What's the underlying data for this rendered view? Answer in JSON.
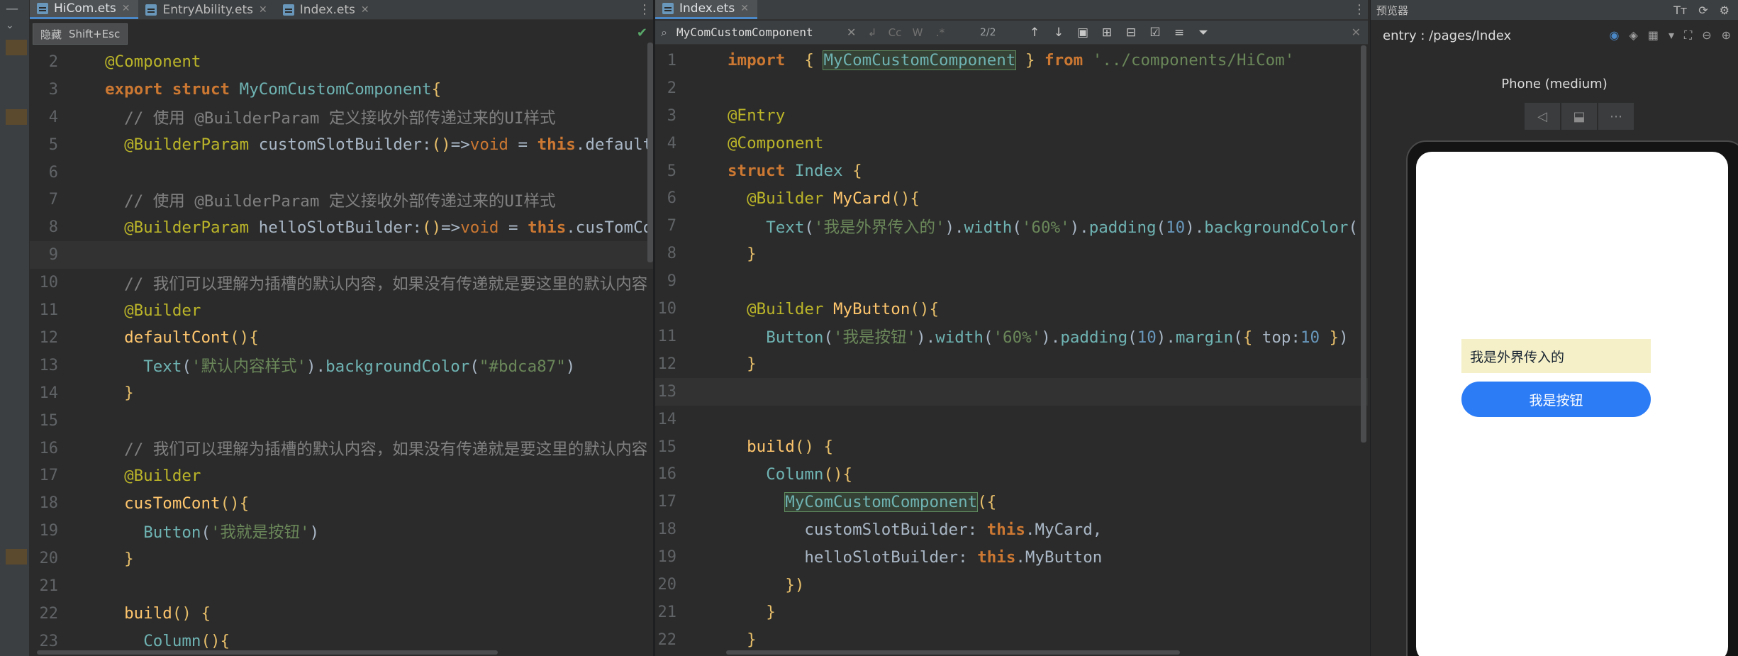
{
  "left_editor": {
    "tabs": [
      {
        "label": "HiCom.ets",
        "active": true
      },
      {
        "label": "EntryAbility.ets",
        "active": false
      },
      {
        "label": "Index.ets",
        "active": false
      }
    ],
    "tooltip": {
      "text": "隐藏",
      "shortcut": "Shift+Esc"
    },
    "lines": [
      {
        "n": "2",
        "html": "<span class=\"ann\">@Component</span>"
      },
      {
        "n": "3",
        "html": "<span class=\"kw\">export struct </span><span class=\"cls\">MyComCustomComponent</span><span class=\"sym\">{</span>"
      },
      {
        "n": "4",
        "html": "  <span class=\"cm\">// 使用 @BuilderParam 定义接收外部传递过来的UI样式</span>"
      },
      {
        "n": "5",
        "html": "  <span class=\"ann\">@BuilderParam</span> customSlotBuilder:<span class=\"sym\">()</span>=&gt;<span class=\"kw2\">void</span> = <span class=\"kw\">this</span>.defaultCont"
      },
      {
        "n": "6",
        "html": ""
      },
      {
        "n": "7",
        "html": "  <span class=\"cm\">// 使用 @BuilderParam 定义接收外部传递过来的UI样式</span>"
      },
      {
        "n": "8",
        "html": "  <span class=\"ann\">@BuilderParam</span> helloSlotBuilder:<span class=\"sym\">()</span>=&gt;<span class=\"kw2\">void</span> = <span class=\"kw\">this</span>.cusTomCont"
      },
      {
        "n": "9",
        "html": "",
        "current": true
      },
      {
        "n": "10",
        "html": "  <span class=\"cm\">// 我们可以理解为插槽的默认内容，如果没有传递就是要这里的默认内容</span>"
      },
      {
        "n": "11",
        "html": "  <span class=\"ann\">@Builder</span>"
      },
      {
        "n": "12",
        "html": "  <span class=\"fn\">defaultCont</span><span class=\"sym\">(){</span>"
      },
      {
        "n": "13",
        "html": "    <span class=\"cls\">Text</span>(<span class=\"str\">'默认内容样式'</span>).<span class=\"cls\">backgroundColor</span>(<span class=\"str\">\"#bdca87\"</span>)"
      },
      {
        "n": "14",
        "html": "  <span class=\"sym\">}</span>"
      },
      {
        "n": "15",
        "html": ""
      },
      {
        "n": "16",
        "html": "  <span class=\"cm\">// 我们可以理解为插槽的默认内容，如果没有传递就是要这里的默认内容</span>"
      },
      {
        "n": "17",
        "html": "  <span class=\"ann\">@Builder</span>"
      },
      {
        "n": "18",
        "html": "  <span class=\"fn\">cusTomCont</span><span class=\"sym\">(){</span>"
      },
      {
        "n": "19",
        "html": "    <span class=\"cls\">Button</span>(<span class=\"str\">'我就是按钮'</span>)"
      },
      {
        "n": "20",
        "html": "  <span class=\"sym\">}</span>"
      },
      {
        "n": "21",
        "html": ""
      },
      {
        "n": "22",
        "html": "  <span class=\"fn\">build</span><span class=\"sym\">() {</span>"
      },
      {
        "n": "23",
        "html": "    <span class=\"cls\">Column</span><span class=\"sym\">(){</span>"
      }
    ]
  },
  "mid_editor": {
    "tabs": [
      {
        "label": "Index.ets",
        "active": true
      }
    ],
    "search": {
      "value": "MyComCustomComponent",
      "match_case": "Cc",
      "words": "W",
      "regex": ".*",
      "count": "2/2"
    },
    "lines": [
      {
        "n": "1",
        "html": "<span class=\"kw\">import</span>  <span class=\"sym\">{</span> <span class=\"cls hl\">MyComCustomComponent</span> <span class=\"sym\">}</span> <span class=\"kw\">from</span> <span class=\"str\">'../components/HiCom'</span>"
      },
      {
        "n": "2",
        "html": ""
      },
      {
        "n": "3",
        "html": "<span class=\"ann\">@Entry</span>"
      },
      {
        "n": "4",
        "html": "<span class=\"ann\">@Component</span>"
      },
      {
        "n": "5",
        "html": "<span class=\"kw\">struct </span><span class=\"cls\">Index</span> <span class=\"sym\">{</span>"
      },
      {
        "n": "6",
        "html": "  <span class=\"ann\">@Builder</span> <span class=\"fn\">MyCard</span><span class=\"sym\">(){</span>"
      },
      {
        "n": "7",
        "html": "    <span class=\"cls\">Text</span>(<span class=\"str\">'我是外界传入的'</span>).<span class=\"cls\">width</span>(<span class=\"str\">'60%'</span>).<span class=\"cls\">padding</span>(<span class=\"num\">10</span>).<span class=\"cls\">backgroundColor</span>("
      },
      {
        "n": "8",
        "html": "  <span class=\"sym\">}</span>"
      },
      {
        "n": "9",
        "html": ""
      },
      {
        "n": "10",
        "html": "  <span class=\"ann\">@Builder</span> <span class=\"fn\">MyButton</span><span class=\"sym\">(){</span>"
      },
      {
        "n": "11",
        "html": "    <span class=\"cls\">Button</span>(<span class=\"str\">'我是按钮'</span>).<span class=\"cls\">width</span>(<span class=\"str\">'60%'</span>).<span class=\"cls\">padding</span>(<span class=\"num\">10</span>).<span class=\"cls\">margin</span>(<span class=\"sym\">{</span> top:<span class=\"num\">10</span> <span class=\"sym\">}</span>)"
      },
      {
        "n": "12",
        "html": "  <span class=\"sym\">}</span>"
      },
      {
        "n": "13",
        "html": "",
        "current": true
      },
      {
        "n": "14",
        "html": ""
      },
      {
        "n": "15",
        "html": "  <span class=\"fn\">build</span><span class=\"sym\">() {</span>"
      },
      {
        "n": "16",
        "html": "    <span class=\"cls\">Column</span><span class=\"sym\">(){</span>"
      },
      {
        "n": "17",
        "html": "      <span class=\"cls hl\">MyComCustomComponent</span><span class=\"sym\">({</span>"
      },
      {
        "n": "18",
        "html": "        customSlotBuilder: <span class=\"kw\">this</span>.MyCard,"
      },
      {
        "n": "19",
        "html": "        helloSlotBuilder: <span class=\"kw\">this</span>.MyButton"
      },
      {
        "n": "20",
        "html": "      <span class=\"sym\">})</span>"
      },
      {
        "n": "21",
        "html": "    <span class=\"sym\">}</span>"
      },
      {
        "n": "22",
        "html": "  <span class=\"sym\">}</span>"
      }
    ]
  },
  "preview": {
    "title": "预览器",
    "path": "entry : /pages/Index",
    "device": "Phone (medium)",
    "card_text": "我是外界传入的",
    "button_text": "我是按钮"
  }
}
